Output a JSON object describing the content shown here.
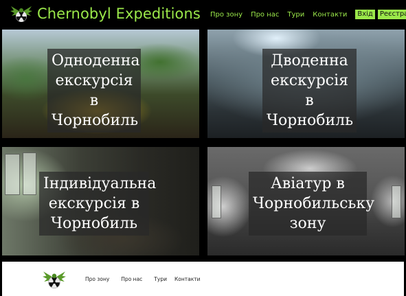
{
  "header": {
    "title": "Chernobyl Expeditions",
    "logo_icon": "radiation-bat-logo-icon",
    "nav": [
      "Про зону",
      "Про нас",
      "Тури",
      "Контакти"
    ],
    "buttons": [
      "Вхід",
      "Реєстрація"
    ]
  },
  "tiles": [
    {
      "caption": "Одноденна екскурсія в Чорнобиль"
    },
    {
      "caption": "Дводенна екскурсія в Чорнобиль"
    },
    {
      "caption": "Індивідуальна екскурсія в Чорнобиль"
    },
    {
      "caption": "Авіатур в Чорнобильську зону"
    }
  ],
  "footer": {
    "logo_icon": "radiation-bat-logo-icon",
    "nav": [
      "Про зону",
      "Про нас",
      "Тури",
      "Контакти"
    ]
  },
  "colors": {
    "accent": "#9be84a",
    "header_bg": "#000000",
    "footer_bg": "#ffffff"
  }
}
